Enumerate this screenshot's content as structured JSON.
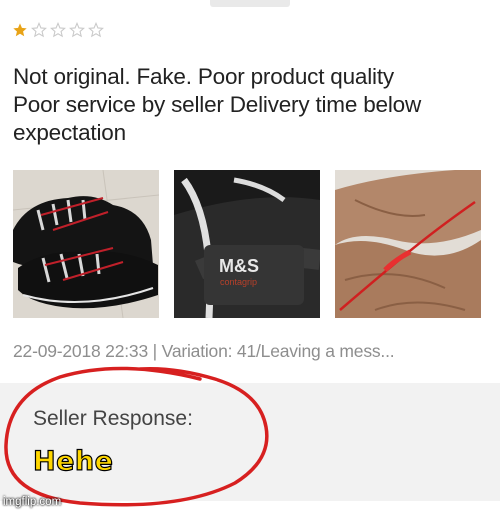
{
  "review": {
    "rating": 1,
    "max_rating": 5,
    "text": "Not original. Fake. Poor product quality\nPoor service by seller  Delivery time below\nexpectation",
    "meta": "22-09-2018 22:33 | Variation: 41/Leaving a mess..."
  },
  "photos": {
    "photo2_logo": "M&S",
    "photo2_sublogo": "contagrip"
  },
  "seller": {
    "label": "Seller Response:",
    "reply": "Hehe"
  },
  "watermark": "imgflip.com",
  "colors": {
    "star_filled": "#e8a317",
    "star_empty": "#c9c9c9",
    "annotation_circle": "#d72020",
    "reply_text": "#ffd700"
  }
}
